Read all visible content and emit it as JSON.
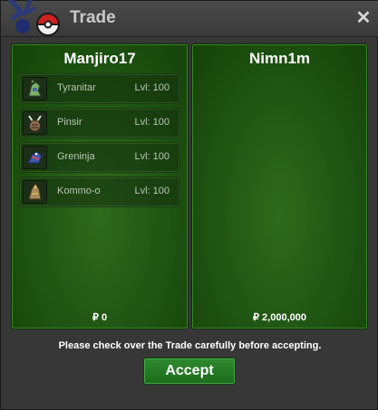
{
  "window": {
    "title": "Trade",
    "close_glyph": "✕"
  },
  "left_panel": {
    "player": "Manjiro17",
    "pokemon": [
      {
        "name": "Tyranitar",
        "level": "Lvl: 100",
        "icon": "tyranitar-icon"
      },
      {
        "name": "Pinsir",
        "level": "Lvl: 100",
        "icon": "pinsir-icon"
      },
      {
        "name": "Greninja",
        "level": "Lvl: 100",
        "icon": "greninja-icon"
      },
      {
        "name": "Kommo-o",
        "level": "Lvl: 100",
        "icon": "kommo-o-icon"
      }
    ],
    "money": "₽ 0"
  },
  "right_panel": {
    "player": "Nimn1m",
    "pokemon": [],
    "money": "₽ 2,000,000"
  },
  "footer": {
    "notice": "Please check over the Trade carefully before accepting.",
    "accept_label": "Accept"
  },
  "colors": {
    "panel_green": "#1f5412",
    "accept_green": "#2e8a2e",
    "window_bg": "#373737"
  }
}
